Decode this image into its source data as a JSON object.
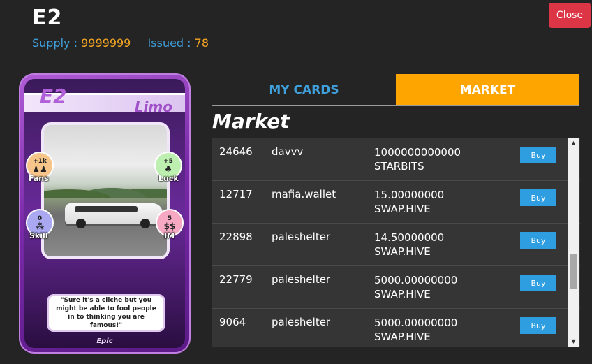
{
  "header": {
    "title": "E2",
    "supply_label": "Supply :",
    "supply_value": "9999999",
    "issued_label": "Issued :",
    "issued_value": "78",
    "close_label": "Close"
  },
  "card": {
    "code": "E2",
    "name": "Limo",
    "stats": {
      "fans": {
        "value": "+1k",
        "label": "Fans"
      },
      "luck": {
        "value": "+5",
        "label": "Luck"
      },
      "skill": {
        "value": "0",
        "label": "Skill"
      },
      "im": {
        "value": "5",
        "label": "IM"
      }
    },
    "quote": "\"Sure it's a cliche but you might be able to fool people in to thinking you are famous!\"",
    "rarity": "Epic"
  },
  "tabs": {
    "my_cards": "MY CARDS",
    "market": "MARKET"
  },
  "market": {
    "title": "Market",
    "buy_label": "Buy",
    "listings": [
      {
        "id": "24646",
        "seller": "davvv",
        "amount": "1000000000000",
        "currency": "STARBITS"
      },
      {
        "id": "12717",
        "seller": "mafia.wallet",
        "amount": "15.00000000",
        "currency": "SWAP.HIVE"
      },
      {
        "id": "22898",
        "seller": "paleshelter",
        "amount": "14.50000000",
        "currency": "SWAP.HIVE"
      },
      {
        "id": "22779",
        "seller": "paleshelter",
        "amount": "5000.00000000",
        "currency": "SWAP.HIVE"
      },
      {
        "id": "9064",
        "seller": "paleshelter",
        "amount": "5000.00000000",
        "currency": "SWAP.HIVE"
      }
    ]
  },
  "colors": {
    "accent_blue": "#3fa0dc",
    "accent_orange": "#f5a623",
    "tab_active": "#ffa500",
    "close_red": "#dc3545",
    "buy_blue": "#2e9ee0"
  }
}
